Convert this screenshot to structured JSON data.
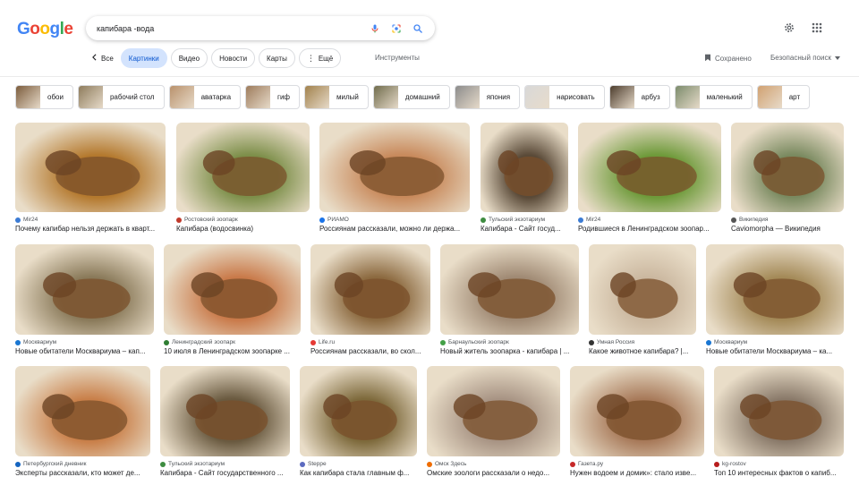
{
  "logo": [
    "G",
    "o",
    "o",
    "g",
    "l",
    "e"
  ],
  "search": {
    "query": "капибара -вода"
  },
  "tabs": {
    "all": "Все",
    "images": "Картинки",
    "video": "Видео",
    "news": "Новости",
    "maps": "Карты",
    "more": "Ещё"
  },
  "tools": "Инструменты",
  "saved": "Сохранено",
  "safesearch": "Безопасный поиск",
  "chips": [
    {
      "label": "обои"
    },
    {
      "label": "рабочий стол"
    },
    {
      "label": "аватарка"
    },
    {
      "label": "гиф"
    },
    {
      "label": "милый"
    },
    {
      "label": "домашний"
    },
    {
      "label": "япония"
    },
    {
      "label": "нарисовать"
    },
    {
      "label": "арбуз"
    },
    {
      "label": "маленький"
    },
    {
      "label": "арт"
    }
  ],
  "results": [
    {
      "source": "Mir24",
      "title": "Почему капибар нельзя держать в кварт...",
      "favicon": "#3b7bd4",
      "bg": "#b4792e"
    },
    {
      "source": "Ростовский зоопарк",
      "title": "Капибара (водосвинка)",
      "favicon": "#c0392b",
      "bg": "#7d8f4a"
    },
    {
      "source": "РИАМО",
      "title": "Россиянам рассказали, можно ли держа...",
      "favicon": "#1a73e8",
      "bg": "#c88a5c"
    },
    {
      "source": "Тульский экзотариум",
      "title": "Капибара - Сайт госуд...",
      "favicon": "#3d8c40",
      "bg": "#5a4a38"
    },
    {
      "source": "Mir24",
      "title": "Родившиеся в Ленинградском зоопар...",
      "favicon": "#3b7bd4",
      "bg": "#6e9a3a"
    },
    {
      "source": "Википедия",
      "title": "Caviomorpha — Википедия",
      "favicon": "#555555",
      "bg": "#7a8a60"
    },
    {
      "source": "Москвариум",
      "title": "Новые обитатели Москвариума – кап...",
      "favicon": "#1976d2",
      "bg": "#8a7a5a"
    },
    {
      "source": "Ленинградский зоопарк",
      "title": "10 июля в Ленинградском зоопарке ...",
      "favicon": "#2e7d32",
      "bg": "#c97a4a"
    },
    {
      "source": "Life.ru",
      "title": "Россиянам рассказали, во скол...",
      "favicon": "#e53935",
      "bg": "#8c6a40"
    },
    {
      "source": "Барнаульский зоопарк",
      "title": "Новый житель зоопарка - капибара | ...",
      "favicon": "#43a047",
      "bg": "#a08a74"
    },
    {
      "source": "Умная Россия",
      "title": "Какое животное капибара? |...",
      "favicon": "#333333",
      "bg": "#cbb8a0"
    },
    {
      "source": "Москвариум",
      "title": "Новые обитатели Москвариума – ка...",
      "favicon": "#1976d2",
      "bg": "#a48a58"
    },
    {
      "source": "Петербургский дневник",
      "title": "Эксперты рассказали, кто может де...",
      "favicon": "#1565c0",
      "bg": "#c9804a"
    },
    {
      "source": "Тульский экзотариум",
      "title": "Капибара - Сайт государственного ...",
      "favicon": "#3d8c40",
      "bg": "#6a5a40"
    },
    {
      "source": "Steppe",
      "title": "Как капибара стала главным ф...",
      "favicon": "#5c6bc0",
      "bg": "#7e6a3c"
    },
    {
      "source": "Омск Здесь",
      "title": "Омские зоологи рассказали о недо...",
      "favicon": "#ef6c00",
      "bg": "#a89484"
    },
    {
      "source": "Газета.ру",
      "title": "Нужен водоем и домик»: стало изве...",
      "favicon": "#c62828",
      "bg": "#a87a5a"
    },
    {
      "source": "kg-rostov",
      "title": "Топ 10 интересных фактов о капиб...",
      "favicon": "#b71c1c",
      "bg": "#8a7a6a"
    }
  ],
  "colors": {
    "accent": "#0b57d0",
    "active_tab_bg": "#d3e3fd"
  }
}
